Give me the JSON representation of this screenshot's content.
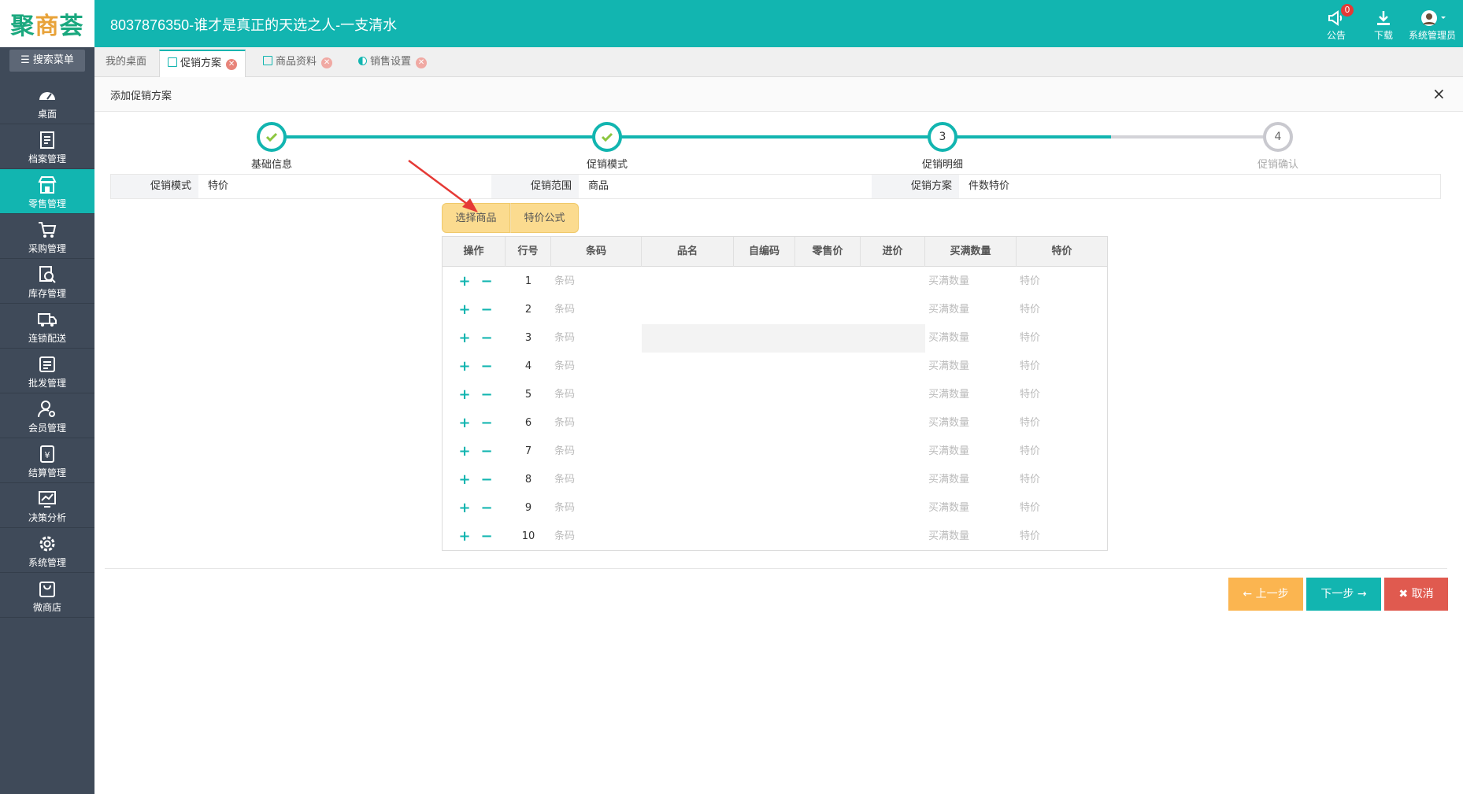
{
  "app": {
    "logo": "聚商荟",
    "title": "8037876350-谁才是真正的天选之人-一支清水"
  },
  "header_actions": {
    "notice_label": "公告",
    "notice_count": "0",
    "download_label": "下载",
    "user_label": "系统管理员"
  },
  "sidebar": {
    "search_label": "搜索菜单",
    "items": [
      {
        "label": "桌面",
        "icon": "dashboard-icon"
      },
      {
        "label": "档案管理",
        "icon": "archive-icon"
      },
      {
        "label": "零售管理",
        "icon": "store-icon",
        "active": true
      },
      {
        "label": "采购管理",
        "icon": "cart-icon"
      },
      {
        "label": "库存管理",
        "icon": "inventory-icon"
      },
      {
        "label": "连锁配送",
        "icon": "truck-icon"
      },
      {
        "label": "批发管理",
        "icon": "wholesale-icon"
      },
      {
        "label": "会员管理",
        "icon": "member-icon"
      },
      {
        "label": "结算管理",
        "icon": "settlement-icon"
      },
      {
        "label": "决策分析",
        "icon": "chart-icon"
      },
      {
        "label": "系统管理",
        "icon": "gear-icon"
      },
      {
        "label": "微商店",
        "icon": "bag-icon"
      }
    ]
  },
  "tabs": [
    {
      "label": "我的桌面"
    },
    {
      "label": "促销方案",
      "active": true
    },
    {
      "label": "商品资料"
    },
    {
      "label": "销售设置"
    }
  ],
  "panel": {
    "title": "添加促销方案",
    "close": "×"
  },
  "steps": [
    {
      "label": "基础信息",
      "state": "done"
    },
    {
      "label": "促销模式",
      "state": "done"
    },
    {
      "label": "促销明细",
      "number": "3",
      "state": "current"
    },
    {
      "label": "促销确认",
      "number": "4",
      "state": "todo"
    }
  ],
  "info": {
    "mode_label": "促销模式",
    "mode_value": "特价",
    "scope_label": "促销范围",
    "scope_value": "商品",
    "plan_label": "促销方案",
    "plan_value": "件数特价"
  },
  "actions": {
    "select_goods": "选择商品",
    "price_formula": "特价公式"
  },
  "table": {
    "columns": [
      "操作",
      "行号",
      "条码",
      "品名",
      "自编码",
      "零售价",
      "进价",
      "买满数量",
      "特价"
    ],
    "placeholders": {
      "barcode": "条码",
      "qty": "买满数量",
      "price": "特价"
    },
    "rows": [
      "1",
      "2",
      "3",
      "4",
      "5",
      "6",
      "7",
      "8",
      "9",
      "10"
    ],
    "add_symbol": "+",
    "remove_symbol": "−"
  },
  "footer": {
    "prev": "← 上一步",
    "next": "下一步 →",
    "cancel": "✖ 取消"
  },
  "colors": {
    "accent": "#12b5b0",
    "sidebar": "#3f4a59",
    "prev_button": "#fbb550",
    "next_button": "#12b5b0",
    "cancel_button": "#e05a4f"
  }
}
